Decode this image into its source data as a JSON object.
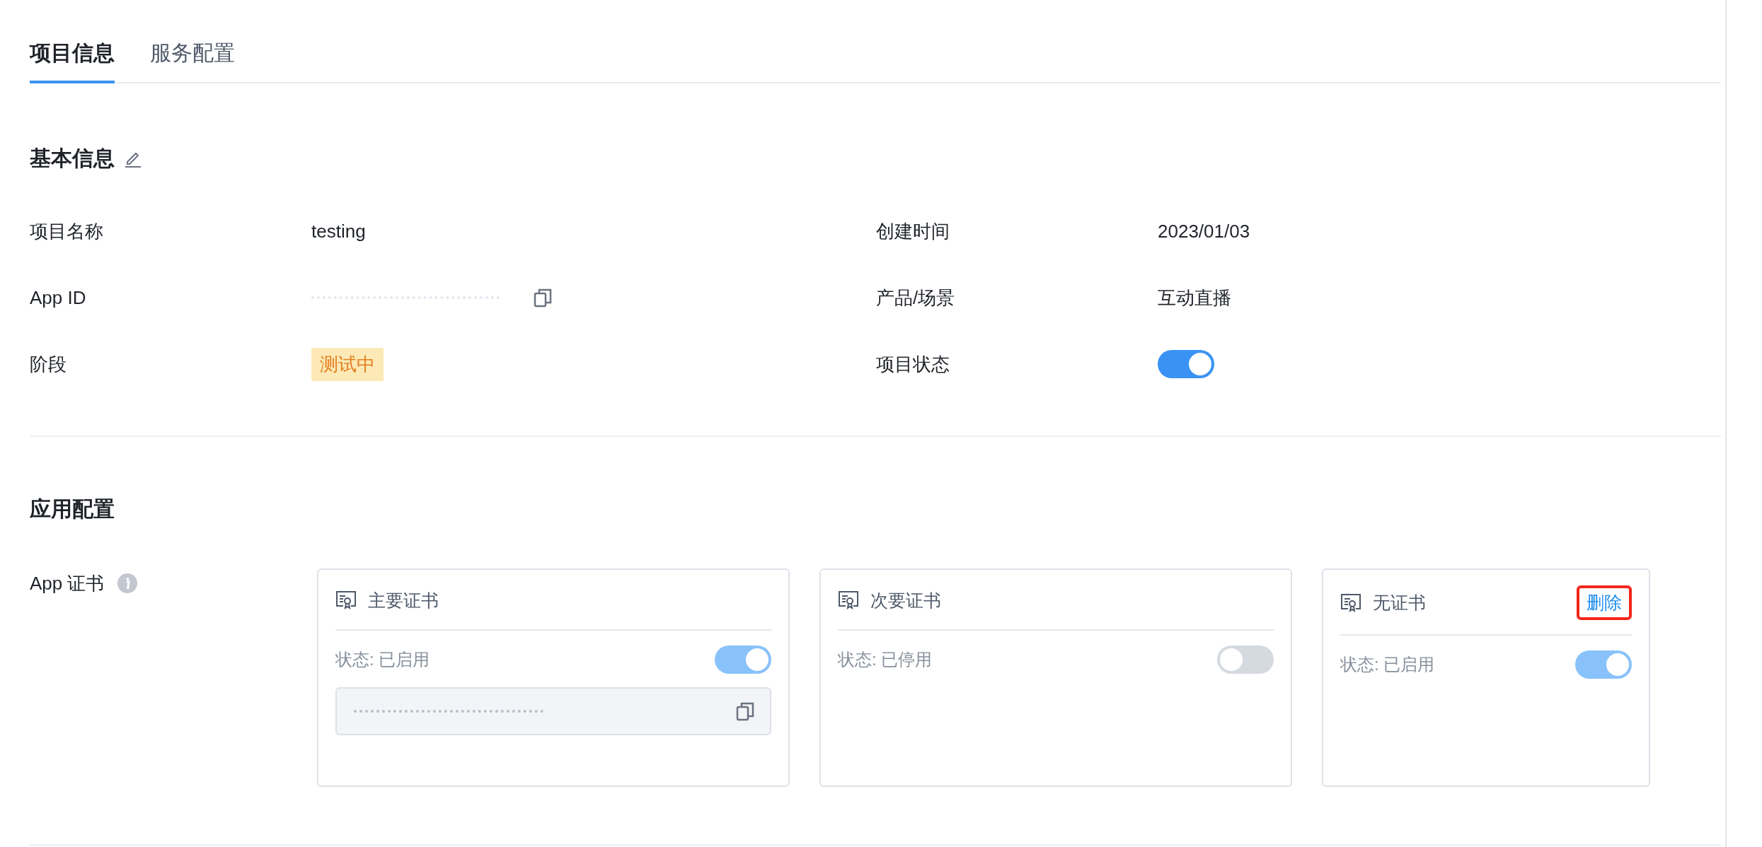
{
  "tabs": [
    {
      "label": "项目信息",
      "selected": true
    },
    {
      "label": "服务配置",
      "selected": false
    }
  ],
  "basic_info": {
    "title": "基本信息",
    "fields": [
      {
        "kind": "text",
        "label": "项目名称",
        "value": "testing"
      },
      {
        "kind": "text",
        "label": "创建时间",
        "value": "2023/01/03"
      },
      {
        "kind": "masked",
        "label": "App ID"
      },
      {
        "kind": "text",
        "label": "产品/场景",
        "value": "互动直播"
      },
      {
        "kind": "tag",
        "label": "阶段",
        "value": "测试中"
      },
      {
        "kind": "toggle",
        "label": "项目状态",
        "on": true
      }
    ]
  },
  "app_config": {
    "title": "应用配置",
    "certificate_label": "App 证书",
    "cards": [
      {
        "kind": "key",
        "title": "主要证书",
        "status": "状态: 已启用",
        "on": true
      },
      {
        "kind": "plain",
        "title": "次要证书",
        "status": "状态: 已停用",
        "on": false
      },
      {
        "kind": "plain",
        "title": "无证书",
        "status": "状态: 已启用",
        "on": true,
        "action": {
          "label": "删除",
          "highlighted": true
        }
      }
    ]
  }
}
